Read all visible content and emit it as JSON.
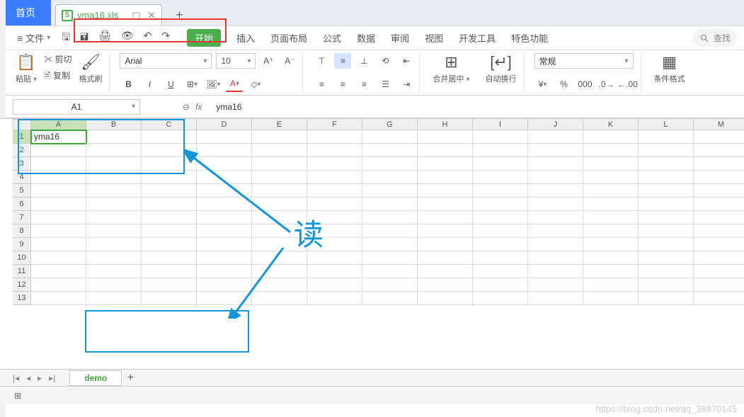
{
  "tabs": {
    "home": "首页",
    "file_icon_letter": "S",
    "file_name": "yma16.xls",
    "new_tab": "+"
  },
  "menu": {
    "file": "文件",
    "items": [
      "开始",
      "插入",
      "页面布局",
      "公式",
      "数据",
      "审阅",
      "视图",
      "开发工具",
      "特色功能"
    ],
    "search": "查找"
  },
  "ribbon": {
    "paste": "粘贴",
    "cut": "剪切",
    "copy": "复制",
    "format_painter": "格式刷",
    "font_name": "Arial",
    "font_size": "10",
    "bold": "B",
    "italic": "I",
    "underline": "U",
    "merge": "合并居中",
    "wrap": "自动换行",
    "number_fmt": "常规",
    "cond_fmt": "条件格式"
  },
  "formula": {
    "cell_ref": "A1",
    "fx": "fx",
    "value": "yma16"
  },
  "grid": {
    "cols": [
      "A",
      "B",
      "C",
      "D",
      "E",
      "F",
      "G",
      "H",
      "I",
      "J",
      "K",
      "L",
      "M"
    ],
    "rows": [
      1,
      2,
      3,
      4,
      5,
      6,
      7,
      8,
      9,
      10,
      11,
      12,
      13
    ],
    "a1": "yma16"
  },
  "annotation": {
    "read": "读"
  },
  "sheets": {
    "active": "demo",
    "add": "+"
  },
  "watermark": "https://blog.csdn.net/qq_38870145"
}
